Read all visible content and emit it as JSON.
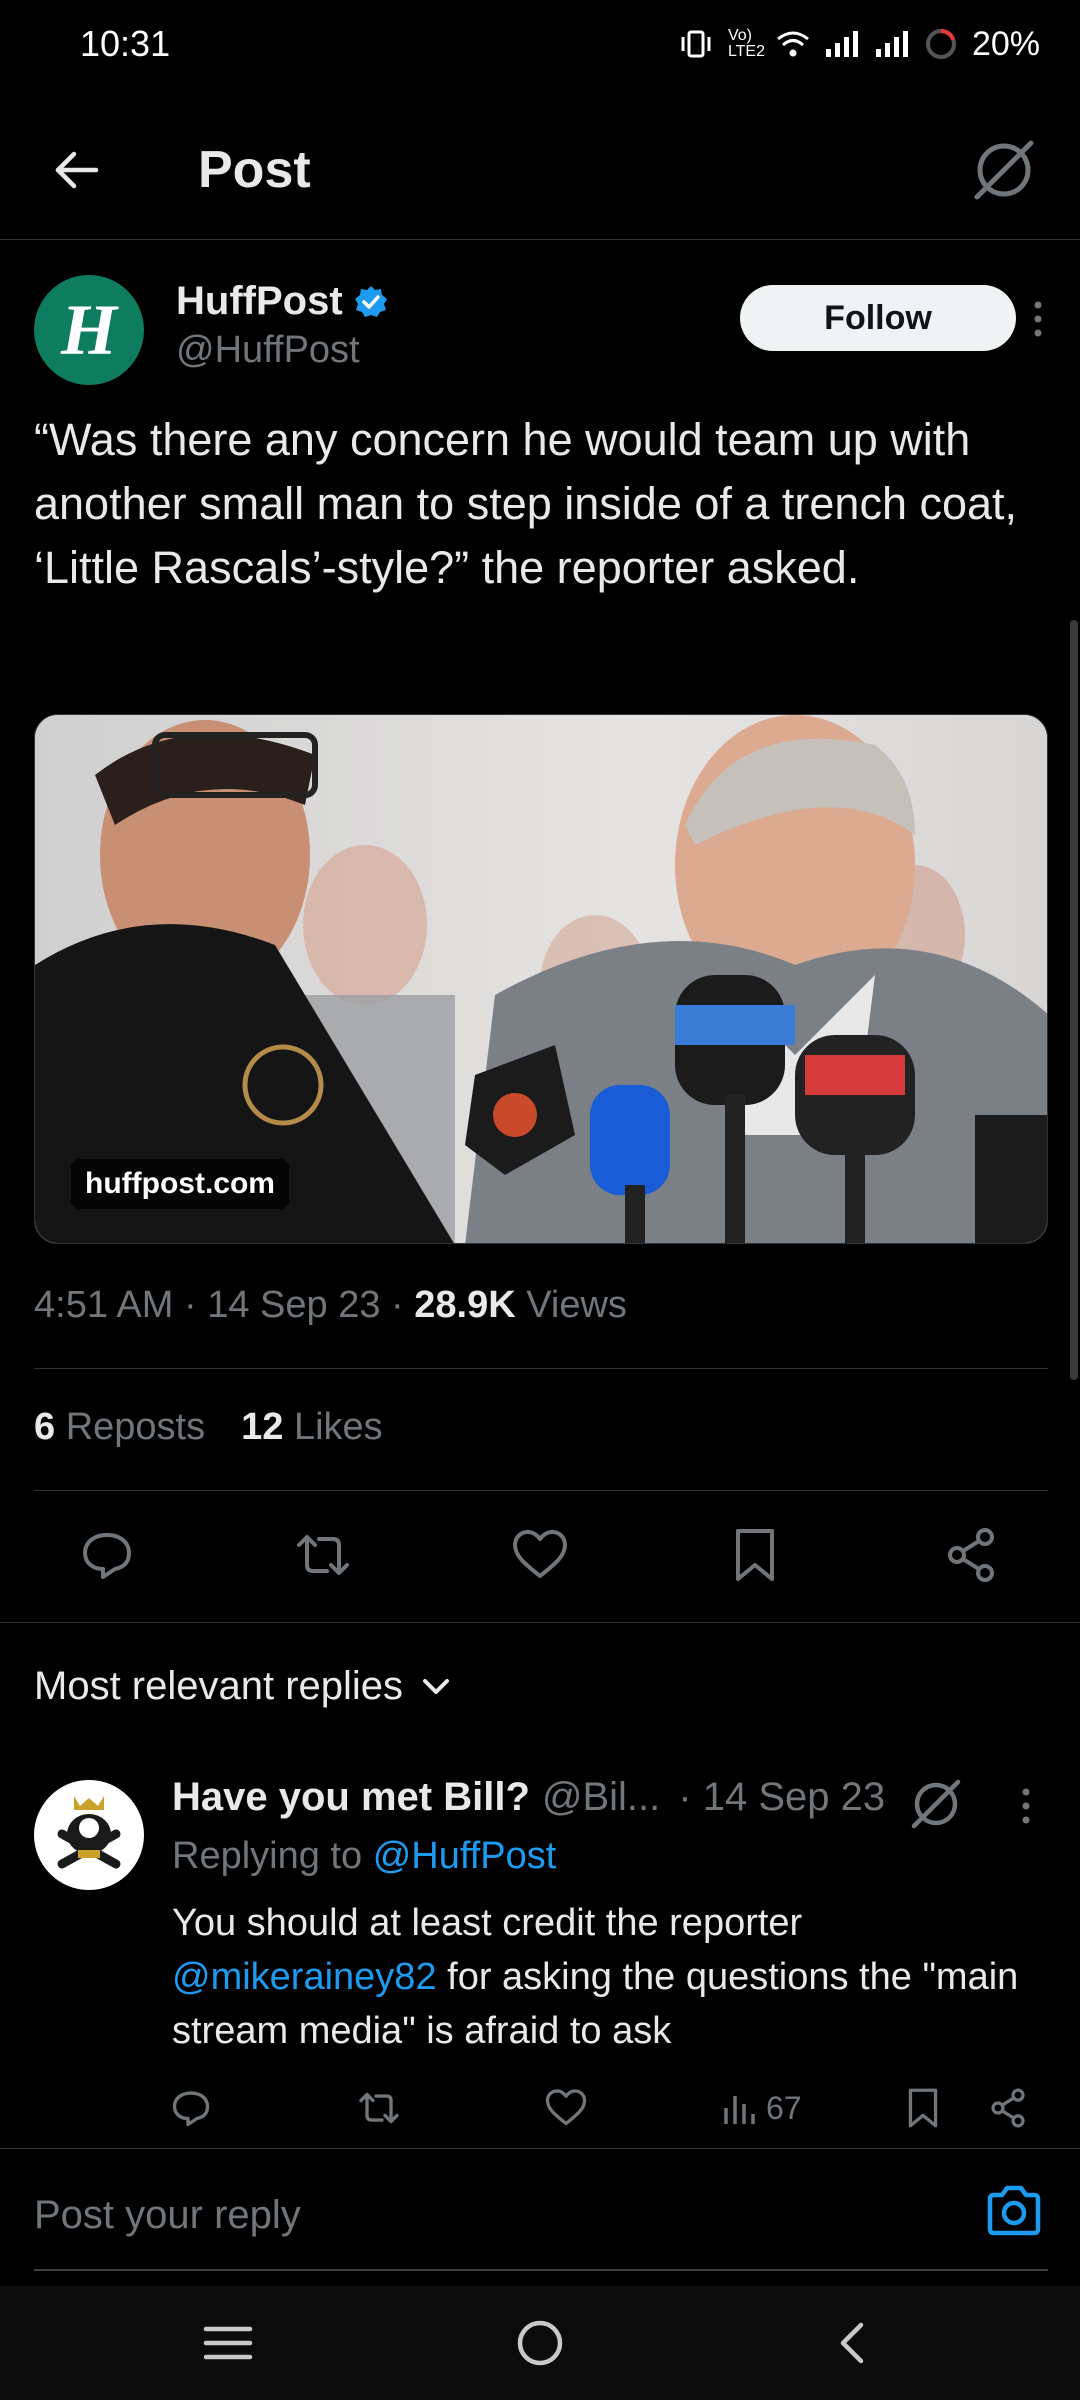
{
  "status_bar": {
    "time": "10:31",
    "network_label": "Vo) LTE2",
    "battery": "20%"
  },
  "header": {
    "title": "Post"
  },
  "post": {
    "author_name": "HuffPost",
    "author_handle": "@HuffPost",
    "avatar_letter": "H",
    "follow_label": "Follow",
    "text": "“Was there any concern he would team up with another small man to step inside of a trench coat, ‘Little Rascals’-style?” the reporter asked.",
    "media_domain": "huffpost.com",
    "time": "4:51 AM",
    "date": "14 Sep 23",
    "views_count": "28.9K",
    "views_label": "Views",
    "reposts_count": "6",
    "reposts_label": "Reposts",
    "likes_count": "12",
    "likes_label": "Likes"
  },
  "replies": {
    "sort_label": "Most relevant replies",
    "items": [
      {
        "name": "Have you met Bill?",
        "handle": "@Bil...",
        "date": "· 14 Sep 23",
        "replying_prefix": "Replying to",
        "replying_to": "@HuffPost",
        "text_before": "You should at least credit the reporter",
        "mention": "@mikerainey82",
        "text_after": "for asking the questions the \"main stream media\" is afraid to ask",
        "views": "67"
      }
    ]
  },
  "compose": {
    "placeholder": "Post your reply"
  },
  "colors": {
    "background": "#000000",
    "text": "#e7e9ea",
    "muted": "#71767b",
    "accent": "#1d9bf0",
    "huffpost_green": "#0d7c5f"
  },
  "icons": [
    "back-arrow-icon",
    "grok-icon",
    "verified-badge-icon",
    "more-vertical-icon",
    "reply-icon",
    "repost-icon",
    "like-icon",
    "bookmark-icon",
    "share-icon",
    "chevron-down-icon",
    "views-icon",
    "camera-icon",
    "menu-icon",
    "home-circle-icon",
    "nav-back-icon"
  ]
}
